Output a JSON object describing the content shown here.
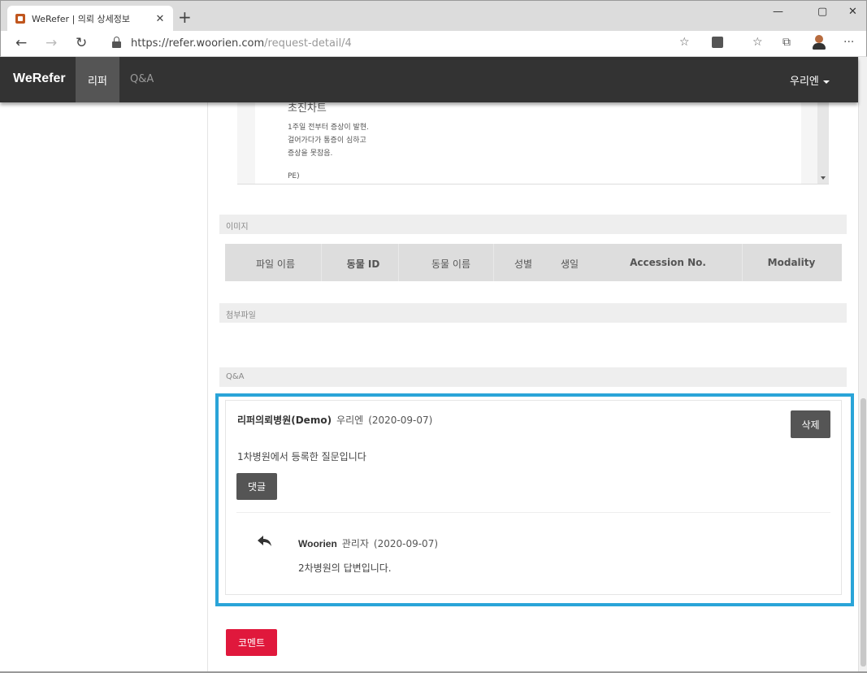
{
  "browser": {
    "tab_title": "WeRefer | 의뢰 상세정보",
    "tab_close": "✕",
    "new_tab": "+",
    "window_controls": [
      "—",
      "▢",
      "✕"
    ],
    "url_scheme_host": "https://refer.woorien.com",
    "url_path": "/request-detail/4",
    "icons": [
      "back-icon",
      "forward-icon",
      "refresh-icon",
      "lock-icon",
      "favorite-star-icon",
      "reader-icon",
      "favorites-list-icon",
      "collections-icon",
      "profile-icon",
      "more-icon"
    ]
  },
  "navbar": {
    "brand": "WeRefer",
    "active_item": "리퍼",
    "item_qa": "Q&A",
    "user": "우리엔"
  },
  "notes": {
    "title": "초진차트",
    "lines": [
      "1주일 전부터 증상이 발현.",
      "걸어가다가 통증이 심하고",
      "증상을 못참음.",
      "",
      "PE)"
    ]
  },
  "sections": {
    "images": "이미지",
    "attachments": "첨부파일",
    "qa": "Q&A"
  },
  "image_table": {
    "columns": [
      "파일 이름",
      "동물 ID",
      "동물 이름",
      "성별",
      "생일",
      "Accession No.",
      "Modality"
    ]
  },
  "question": {
    "org": "리퍼의뢰병원(Demo)",
    "author": "우리엔",
    "date": "(2020-09-07)",
    "body": "1차병원에서 등록한 질문입니다",
    "delete_label": "삭제",
    "reply_label": "댓글"
  },
  "answer": {
    "author": "Woorien",
    "role": "관리자",
    "date": "(2020-09-07)",
    "body": "2차병원의 답변입니다."
  },
  "comment_label": "코멘트",
  "colors": {
    "navbar": "#333333",
    "highlight_outline": "#2aa4d8",
    "comment_button": "#e0183c",
    "dark_button": "#555555"
  }
}
